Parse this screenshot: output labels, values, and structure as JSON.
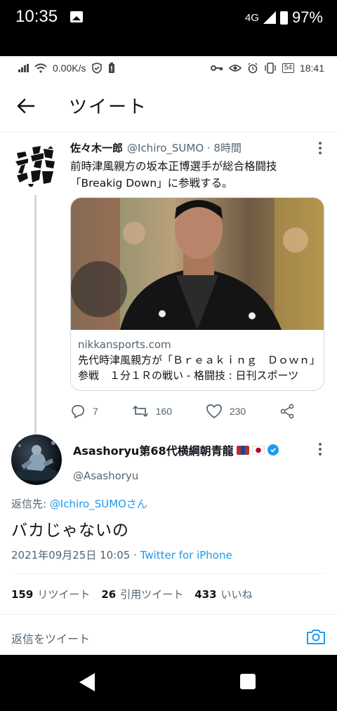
{
  "status_bar": {
    "time": "10:35",
    "network": "4G",
    "battery": "97%"
  },
  "sub_status": {
    "speed": "0.00K/s",
    "battery_level": "54",
    "time": "18:41"
  },
  "header": {
    "title": "ツイート"
  },
  "tweet1": {
    "author_name": "佐々木一郎",
    "author_handle": "@Ichiro_SUMO · 8時間",
    "text_line1": "前時津風親方の坂本正博選手が総合格闘技",
    "text_line2": "「Breakig Down」に参戦する。",
    "card": {
      "domain": "nikkansports.com",
      "title": "先代時津風親方が「Ｂｒｅａｋｉｎｇ　Ｄｏｗｎ」参戦　１分１Ｒの戦い - 格闘技 : 日刊スポーツ"
    },
    "actions": {
      "replies": "7",
      "retweets": "160",
      "likes": "230"
    }
  },
  "tweet2": {
    "author_name": "Asashoryu第68代横綱朝青龍",
    "author_handle": "@Asashoryu",
    "reply_prefix": "返信先: ",
    "reply_to": "@Ichiro_SUMOさん",
    "text": "バカじゃないの",
    "timestamp": "2021年09月25日 10:05 · ",
    "source": "Twitter for iPhone",
    "stats": {
      "retweets_count": "159",
      "retweets_label": "リツイート",
      "quotes_count": "26",
      "quotes_label": "引用ツイート",
      "likes_count": "433",
      "likes_label": "いいね"
    }
  },
  "reply_bar": {
    "placeholder": "返信をツイート"
  },
  "colors": {
    "accent": "#1d9bf0",
    "secondary_text": "#536471",
    "divider": "#eff3f4"
  }
}
